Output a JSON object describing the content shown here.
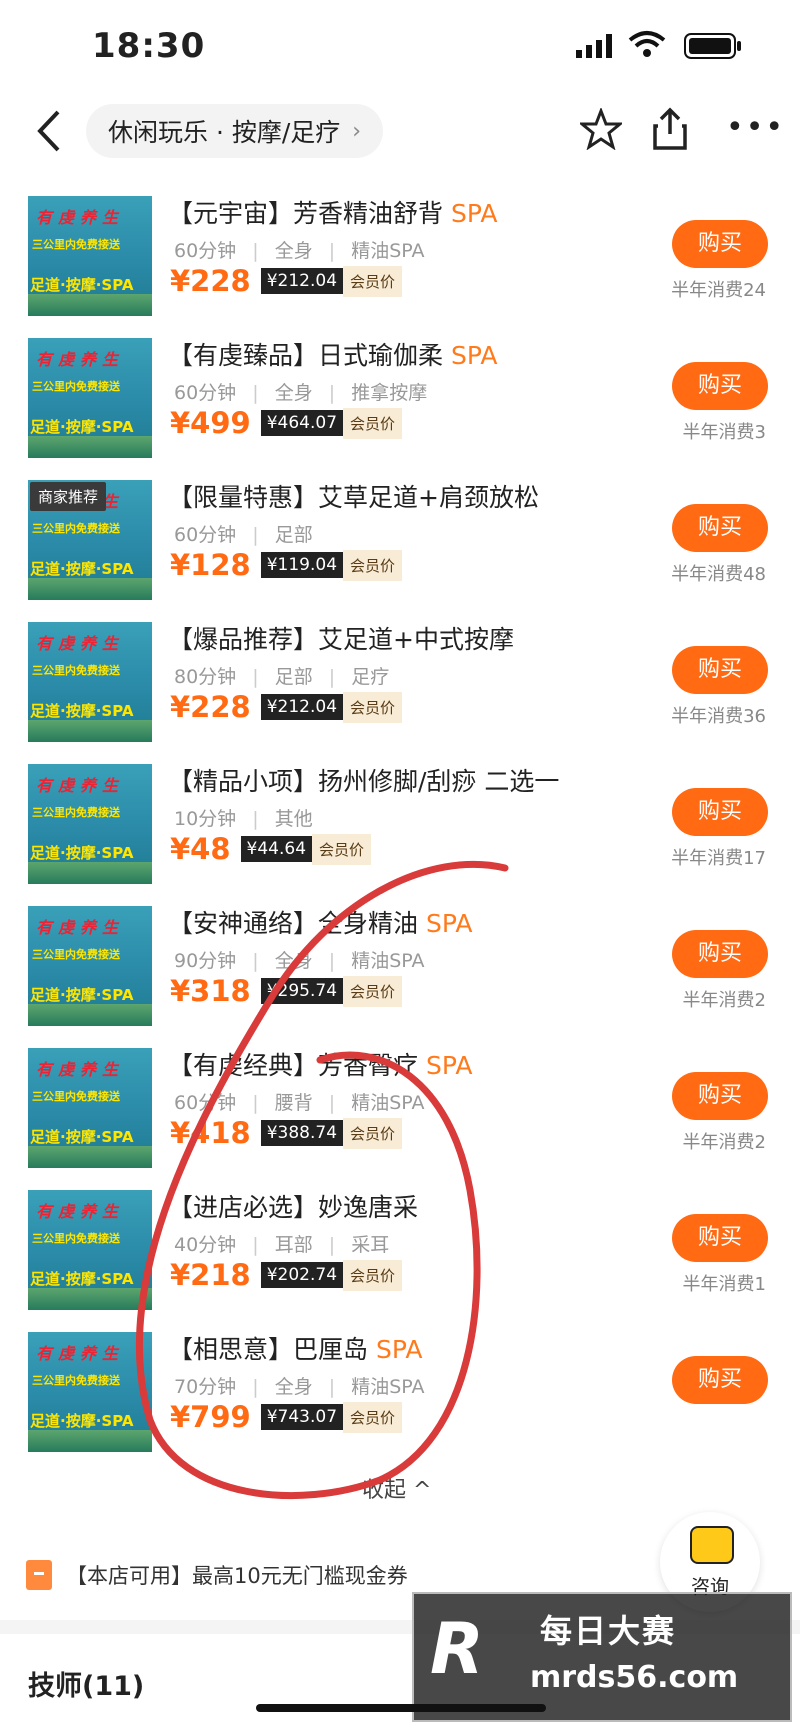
{
  "status": {
    "time": "18:30"
  },
  "nav": {
    "breadcrumb": "休闲玩乐 · 按摩/足疗",
    "chevron": "›"
  },
  "thumbnail": {
    "line1": "有虔养生",
    "line2": "三公里内免费接送",
    "line3": "足道·按摩·SPA"
  },
  "items": [
    {
      "title": "【元宇宙】芳香精油舒背",
      "spa": "SPA",
      "duration": "60分钟",
      "part": "全身",
      "kind": "精油SPA",
      "price": "¥228",
      "vip": "¥212.04",
      "vip_label": "会员价",
      "buy": "购买",
      "sold": "半年消费24",
      "badge": ""
    },
    {
      "title": "【有虔臻品】日式瑜伽柔",
      "spa": "SPA",
      "duration": "60分钟",
      "part": "全身",
      "kind": "推拿按摩",
      "price": "¥499",
      "vip": "¥464.07",
      "vip_label": "会员价",
      "buy": "购买",
      "sold": "半年消费3",
      "badge": ""
    },
    {
      "title": "【限量特惠】艾草足道+肩颈放松",
      "spa": "",
      "duration": "60分钟",
      "part": "足部",
      "kind": "",
      "price": "¥128",
      "vip": "¥119.04",
      "vip_label": "会员价",
      "buy": "购买",
      "sold": "半年消费48",
      "badge": "商家推荐"
    },
    {
      "title": "【爆品推荐】艾足道+中式按摩",
      "spa": "",
      "duration": "80分钟",
      "part": "足部",
      "kind": "足疗",
      "price": "¥228",
      "vip": "¥212.04",
      "vip_label": "会员价",
      "buy": "购买",
      "sold": "半年消费36",
      "badge": ""
    },
    {
      "title": "【精品小项】扬州修脚/刮痧 二选一",
      "spa": "",
      "duration": "10分钟",
      "part": "其他",
      "kind": "",
      "price": "¥48",
      "vip": "¥44.64",
      "vip_label": "会员价",
      "buy": "购买",
      "sold": "半年消费17",
      "badge": ""
    },
    {
      "title": "【安神通络】全身精油",
      "spa": "SPA",
      "duration": "90分钟",
      "part": "全身",
      "kind": "精油SPA",
      "price": "¥318",
      "vip": "¥295.74",
      "vip_label": "会员价",
      "buy": "购买",
      "sold": "半年消费2",
      "badge": ""
    },
    {
      "title": "【有虔经典】芳香臀疗",
      "spa": "SPA",
      "duration": "60分钟",
      "part": "腰背",
      "kind": "精油SPA",
      "price": "¥418",
      "vip": "¥388.74",
      "vip_label": "会员价",
      "buy": "购买",
      "sold": "半年消费2",
      "badge": ""
    },
    {
      "title": "【进店必选】妙逸唐采",
      "spa": "",
      "duration": "40分钟",
      "part": "耳部",
      "kind": "采耳",
      "price": "¥218",
      "vip": "¥202.74",
      "vip_label": "会员价",
      "buy": "购买",
      "sold": "半年消费1",
      "badge": ""
    },
    {
      "title": "【相思意】巴厘岛",
      "spa": "SPA",
      "duration": "70分钟",
      "part": "全身",
      "kind": "精油SPA",
      "price": "¥799",
      "vip": "¥743.07",
      "vip_label": "会员价",
      "buy": "购买",
      "sold": "",
      "badge": ""
    }
  ],
  "collapse": "收起 ^",
  "coupon": "【本店可用】最高10元无门槛现金券",
  "consult": "咨询",
  "section": "技师(11)",
  "watermark": {
    "name": "每日大赛",
    "url": "mrds56.com",
    "logo": "R"
  },
  "colors": {
    "accent": "#ff6a13",
    "circle": "#d93a3a"
  }
}
